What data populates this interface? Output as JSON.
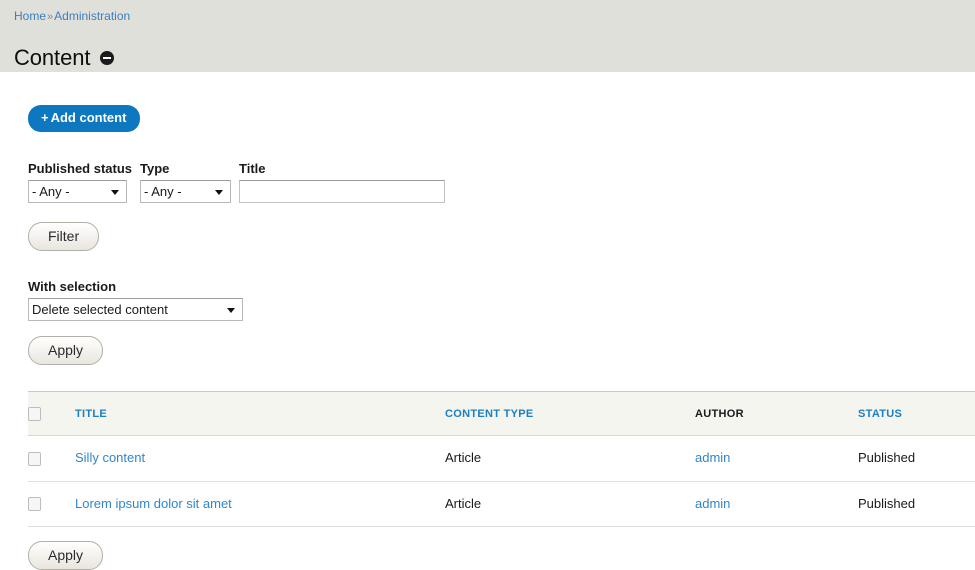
{
  "header": {
    "breadcrumb": [
      {
        "label": "Home"
      },
      {
        "label": "Administration"
      }
    ],
    "breadcrumb_separator": "»",
    "title": "Content",
    "collapse_icon": "minus-circle-icon"
  },
  "actions": {
    "add_content_plus": "+",
    "add_content_label": "Add content"
  },
  "filters": {
    "published_status": {
      "label": "Published status",
      "value": "- Any -",
      "options": [
        "- Any -"
      ]
    },
    "type": {
      "label": "Type",
      "value": "- Any -",
      "options": [
        "- Any -"
      ]
    },
    "title": {
      "label": "Title",
      "value": "",
      "placeholder": ""
    },
    "filter_button": "Filter"
  },
  "bulk": {
    "label": "With selection",
    "action_value": "Delete selected content",
    "action_options": [
      "Delete selected content"
    ],
    "apply_top_label": "Apply",
    "apply_bottom_label": "Apply"
  },
  "table": {
    "select_all_checked": false,
    "columns": [
      {
        "key": "title",
        "label": "TITLE",
        "sortable": true
      },
      {
        "key": "content_type",
        "label": "CONTENT TYPE",
        "sortable": true
      },
      {
        "key": "author",
        "label": "AUTHOR",
        "sortable": false
      },
      {
        "key": "status",
        "label": "STATUS",
        "sortable": true
      }
    ],
    "rows": [
      {
        "checked": false,
        "title": "Silly content",
        "content_type": "Article",
        "author": "admin",
        "status": "Published"
      },
      {
        "checked": false,
        "title": "Lorem ipsum dolor sit amet",
        "content_type": "Article",
        "author": "admin",
        "status": "Published"
      }
    ]
  },
  "colors": {
    "header_band": "#e0e0da",
    "link_blue": "#3b7fc4",
    "primary_button": "#0d77bf",
    "table_head_bg": "#f5f5f0",
    "sort_link": "#1a7fc4"
  }
}
